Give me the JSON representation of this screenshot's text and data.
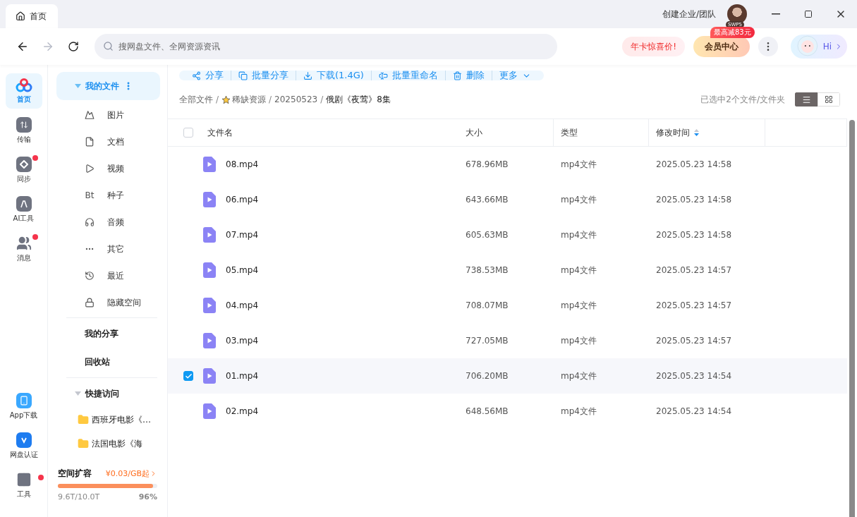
{
  "tab": {
    "label": "首页",
    "selected": true
  },
  "title_bar": {
    "team_link": "创建企业/团队",
    "avatar_badge": "SWP5"
  },
  "toolbar": {
    "search": {
      "placeholder": "搜网盘文件、全网资源资讯"
    },
    "promo": "年卡惊喜价!",
    "vip_button": "会员中心",
    "vip_badge": "最高减83元",
    "assistant": "Hi"
  },
  "rail": [
    {
      "label": "首页",
      "selected": true,
      "badge": false
    },
    {
      "label": "传输",
      "selected": false,
      "badge": false
    },
    {
      "label": "同步",
      "selected": false,
      "badge": true
    },
    {
      "label": "AI工具",
      "selected": false,
      "badge": false
    },
    {
      "label": "消息",
      "selected": false,
      "badge": true
    }
  ],
  "rail_bottom": [
    {
      "label": "App下载",
      "badge": false
    },
    {
      "label": "网盘认证",
      "badge": false
    },
    {
      "label": "工具",
      "badge": true
    }
  ],
  "nav": {
    "header": "我的文件",
    "expanded": true,
    "items": [
      {
        "label": "图片"
      },
      {
        "label": "文档"
      },
      {
        "label": "视频"
      },
      {
        "label": "种子",
        "glyph": "Bt"
      },
      {
        "label": "音频"
      },
      {
        "label": "其它"
      },
      {
        "label": "最近"
      },
      {
        "label": "隐藏空间"
      }
    ],
    "links": [
      "我的分享",
      "回收站"
    ],
    "quick": {
      "header": "快捷访问",
      "expanded": true,
      "items": [
        "西班牙电影《…",
        "法国电影《海"
      ]
    }
  },
  "storage": {
    "title": "空间扩容",
    "offer": "¥0.03/GB起",
    "level": 0.96,
    "used": "9.6T/10.0T",
    "percent": "96%"
  },
  "actions": [
    "分享",
    "批量分享",
    "下载(1.4G)",
    "批量重命名",
    "删除",
    "更多"
  ],
  "breadcrumb": [
    {
      "label": "全部文件"
    },
    {
      "separator": "/",
      "label": "稀缺资源"
    },
    {
      "separator": "/",
      "label": "20250523"
    },
    {
      "separator": "/",
      "label": "俄剧《夜莺》8集"
    }
  ],
  "selection_info": "已选中2个文件/文件夹",
  "view_modes": [
    {
      "selected": true
    },
    {
      "selected": false
    }
  ],
  "table": {
    "header_checked": false,
    "columns": [
      "文件名",
      "大小",
      "类型",
      "修改时间"
    ],
    "rows": [
      {
        "name": "08.mp4",
        "size": "678.96MB",
        "type": "mp4文件",
        "modified": "2025.05.23 14:58",
        "selected": false
      },
      {
        "name": "06.mp4",
        "size": "643.66MB",
        "type": "mp4文件",
        "modified": "2025.05.23 14:58",
        "selected": false
      },
      {
        "name": "07.mp4",
        "size": "605.63MB",
        "type": "mp4文件",
        "modified": "2025.05.23 14:58",
        "selected": false
      },
      {
        "name": "05.mp4",
        "size": "738.53MB",
        "type": "mp4文件",
        "modified": "2025.05.23 14:57",
        "selected": false
      },
      {
        "name": "04.mp4",
        "size": "708.07MB",
        "type": "mp4文件",
        "modified": "2025.05.23 14:57",
        "selected": false
      },
      {
        "name": "03.mp4",
        "size": "727.05MB",
        "type": "mp4文件",
        "modified": "2025.05.23 14:57",
        "selected": false
      },
      {
        "name": "01.mp4",
        "size": "706.20MB",
        "type": "mp4文件",
        "modified": "2025.05.23 14:54",
        "selected": true
      },
      {
        "name": "02.mp4",
        "size": "648.56MB",
        "type": "mp4文件",
        "modified": "2025.05.23 14:54",
        "selected": false
      }
    ]
  }
}
